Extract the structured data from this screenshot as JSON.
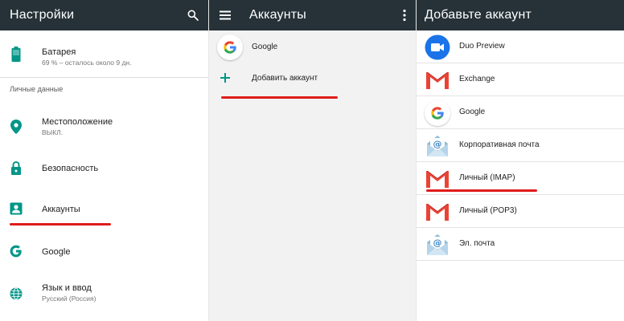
{
  "settings": {
    "title": "Настройки",
    "battery": {
      "title": "Батарея",
      "subtitle": "69 % – осталось около 9 дн."
    },
    "section_personal": "Личные данные",
    "items": [
      {
        "title": "Местоположение",
        "subtitle": "ВЫКЛ."
      },
      {
        "title": "Безопасность",
        "subtitle": ""
      },
      {
        "title": "Аккаунты",
        "subtitle": ""
      },
      {
        "title": "Google",
        "subtitle": ""
      },
      {
        "title": "Язык и ввод",
        "subtitle": "Русский (Россия)"
      }
    ]
  },
  "accounts": {
    "title": "Аккаунты",
    "google_label": "Google",
    "add_label": "Добавить аккаунт"
  },
  "add_account": {
    "title": "Добавьте аккаунт",
    "items": [
      {
        "label": "Duo Preview",
        "icon": "duo-icon"
      },
      {
        "label": "Exchange",
        "icon": "gmail-icon"
      },
      {
        "label": "Google",
        "icon": "google-g-icon"
      },
      {
        "label": "Корпоративная почта",
        "icon": "email-envelope-icon"
      },
      {
        "label": "Личный (IMAP)",
        "icon": "gmail-icon"
      },
      {
        "label": "Личный (POP3)",
        "icon": "gmail-icon"
      },
      {
        "label": "Эл. почта",
        "icon": "email-envelope-icon"
      }
    ]
  },
  "colors": {
    "appbar": "#263238",
    "accent_teal": "#009688",
    "highlight_red": "#e01b1b",
    "google_blue": "#4285F4",
    "google_red": "#EA4335",
    "google_yellow": "#FBBC05",
    "google_green": "#34A853",
    "duo_blue": "#1a73e8"
  }
}
